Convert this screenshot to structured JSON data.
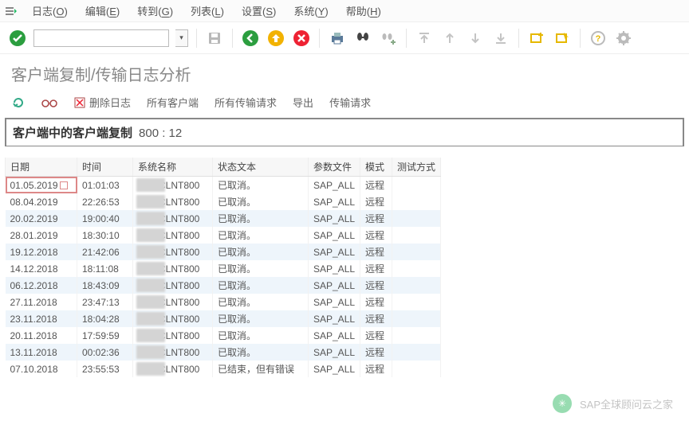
{
  "menu": {
    "log": "日志",
    "log_k": "O",
    "edit": "编辑",
    "edit_k": "E",
    "goto": "转到",
    "goto_k": "G",
    "list": "列表",
    "list_k": "L",
    "settings": "设置",
    "settings_k": "S",
    "system": "系统",
    "system_k": "Y",
    "help": "帮助",
    "help_k": "H"
  },
  "pageTitle": "客户端复制/传输日志分析",
  "subtoolbar": {
    "deleteLog": "删除日志",
    "allClients": "所有客户端",
    "allTransports": "所有传输请求",
    "export": "导出",
    "transports": "传输请求"
  },
  "sectionTitle": "客户端中的客户端复制",
  "sectionSub": "800  :  12",
  "columns": {
    "date": "日期",
    "time": "时间",
    "sysname": "系统名称",
    "status": "状态文本",
    "profile": "参数文件",
    "mode": "模式",
    "test": "测试方式"
  },
  "rows": [
    {
      "date": "01.05.2019",
      "time": "01:01:03",
      "sys": "CLNT800",
      "status": "已取消。",
      "profile": "SAP_ALL",
      "mode": "远程",
      "sel": true
    },
    {
      "date": "08.04.2019",
      "time": "22:26:53",
      "sys": "CLNT800",
      "status": "已取消。",
      "profile": "SAP_ALL",
      "mode": "远程"
    },
    {
      "date": "20.02.2019",
      "time": "19:00:40",
      "sys": "CLNT800",
      "status": "已取消。",
      "profile": "SAP_ALL",
      "mode": "远程"
    },
    {
      "date": "28.01.2019",
      "time": "18:30:10",
      "sys": "CLNT800",
      "status": "已取消。",
      "profile": "SAP_ALL",
      "mode": "远程"
    },
    {
      "date": "19.12.2018",
      "time": "21:42:06",
      "sys": "CLNT800",
      "status": "已取消。",
      "profile": "SAP_ALL",
      "mode": "远程"
    },
    {
      "date": "14.12.2018",
      "time": "18:11:08",
      "sys": "CLNT800",
      "status": "已取消。",
      "profile": "SAP_ALL",
      "mode": "远程"
    },
    {
      "date": "06.12.2018",
      "time": "18:43:09",
      "sys": "CLNT800",
      "status": "已取消。",
      "profile": "SAP_ALL",
      "mode": "远程"
    },
    {
      "date": "27.11.2018",
      "time": "23:47:13",
      "sys": "CLNT800",
      "status": "已取消。",
      "profile": "SAP_ALL",
      "mode": "远程"
    },
    {
      "date": "23.11.2018",
      "time": "18:04:28",
      "sys": "CLNT800",
      "status": "已取消。",
      "profile": "SAP_ALL",
      "mode": "远程"
    },
    {
      "date": "20.11.2018",
      "time": "17:59:59",
      "sys": "CLNT800",
      "status": "已取消。",
      "profile": "SAP_ALL",
      "mode": "远程"
    },
    {
      "date": "13.11.2018",
      "time": "00:02:36",
      "sys": "CLNT800",
      "status": "已取消。",
      "profile": "SAP_ALL",
      "mode": "远程"
    },
    {
      "date": "07.10.2018",
      "time": "23:55:53",
      "sys": "CLNT800",
      "status": "已结束，但有错误",
      "profile": "SAP_ALL",
      "mode": "远程"
    }
  ],
  "watermark": "SAP全球顾问云之家"
}
